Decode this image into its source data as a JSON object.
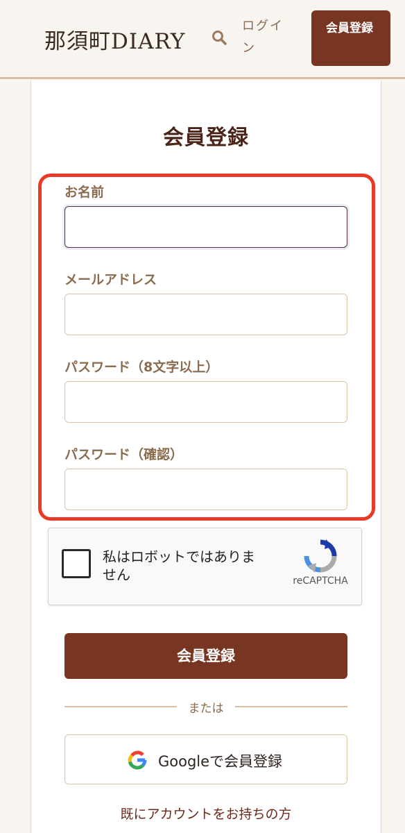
{
  "header": {
    "site_title": "那須町DIARY",
    "search_icon": "search-icon",
    "login_label": "ログイン",
    "register_label": "会員登録"
  },
  "form": {
    "title": "会員登録",
    "fields": [
      {
        "label": "お名前",
        "value": "",
        "focused": true
      },
      {
        "label": "メールアドレス",
        "value": ""
      },
      {
        "label": "パスワード（8文字以上）",
        "value": ""
      },
      {
        "label": "パスワード（確認）",
        "value": ""
      }
    ],
    "recaptcha": {
      "checkbox_label": "私はロボットではありません",
      "brand": "reCAPTCHA",
      "checked": false
    },
    "submit_label": "会員登録",
    "divider_text": "または",
    "google_label": "Googleで会員登録",
    "login_link": "既にアカウントをお持ちの方"
  },
  "colors": {
    "brand": "#783522",
    "highlight": "#e83a26",
    "label": "#8b6b4e",
    "background": "#f8f5f0"
  }
}
